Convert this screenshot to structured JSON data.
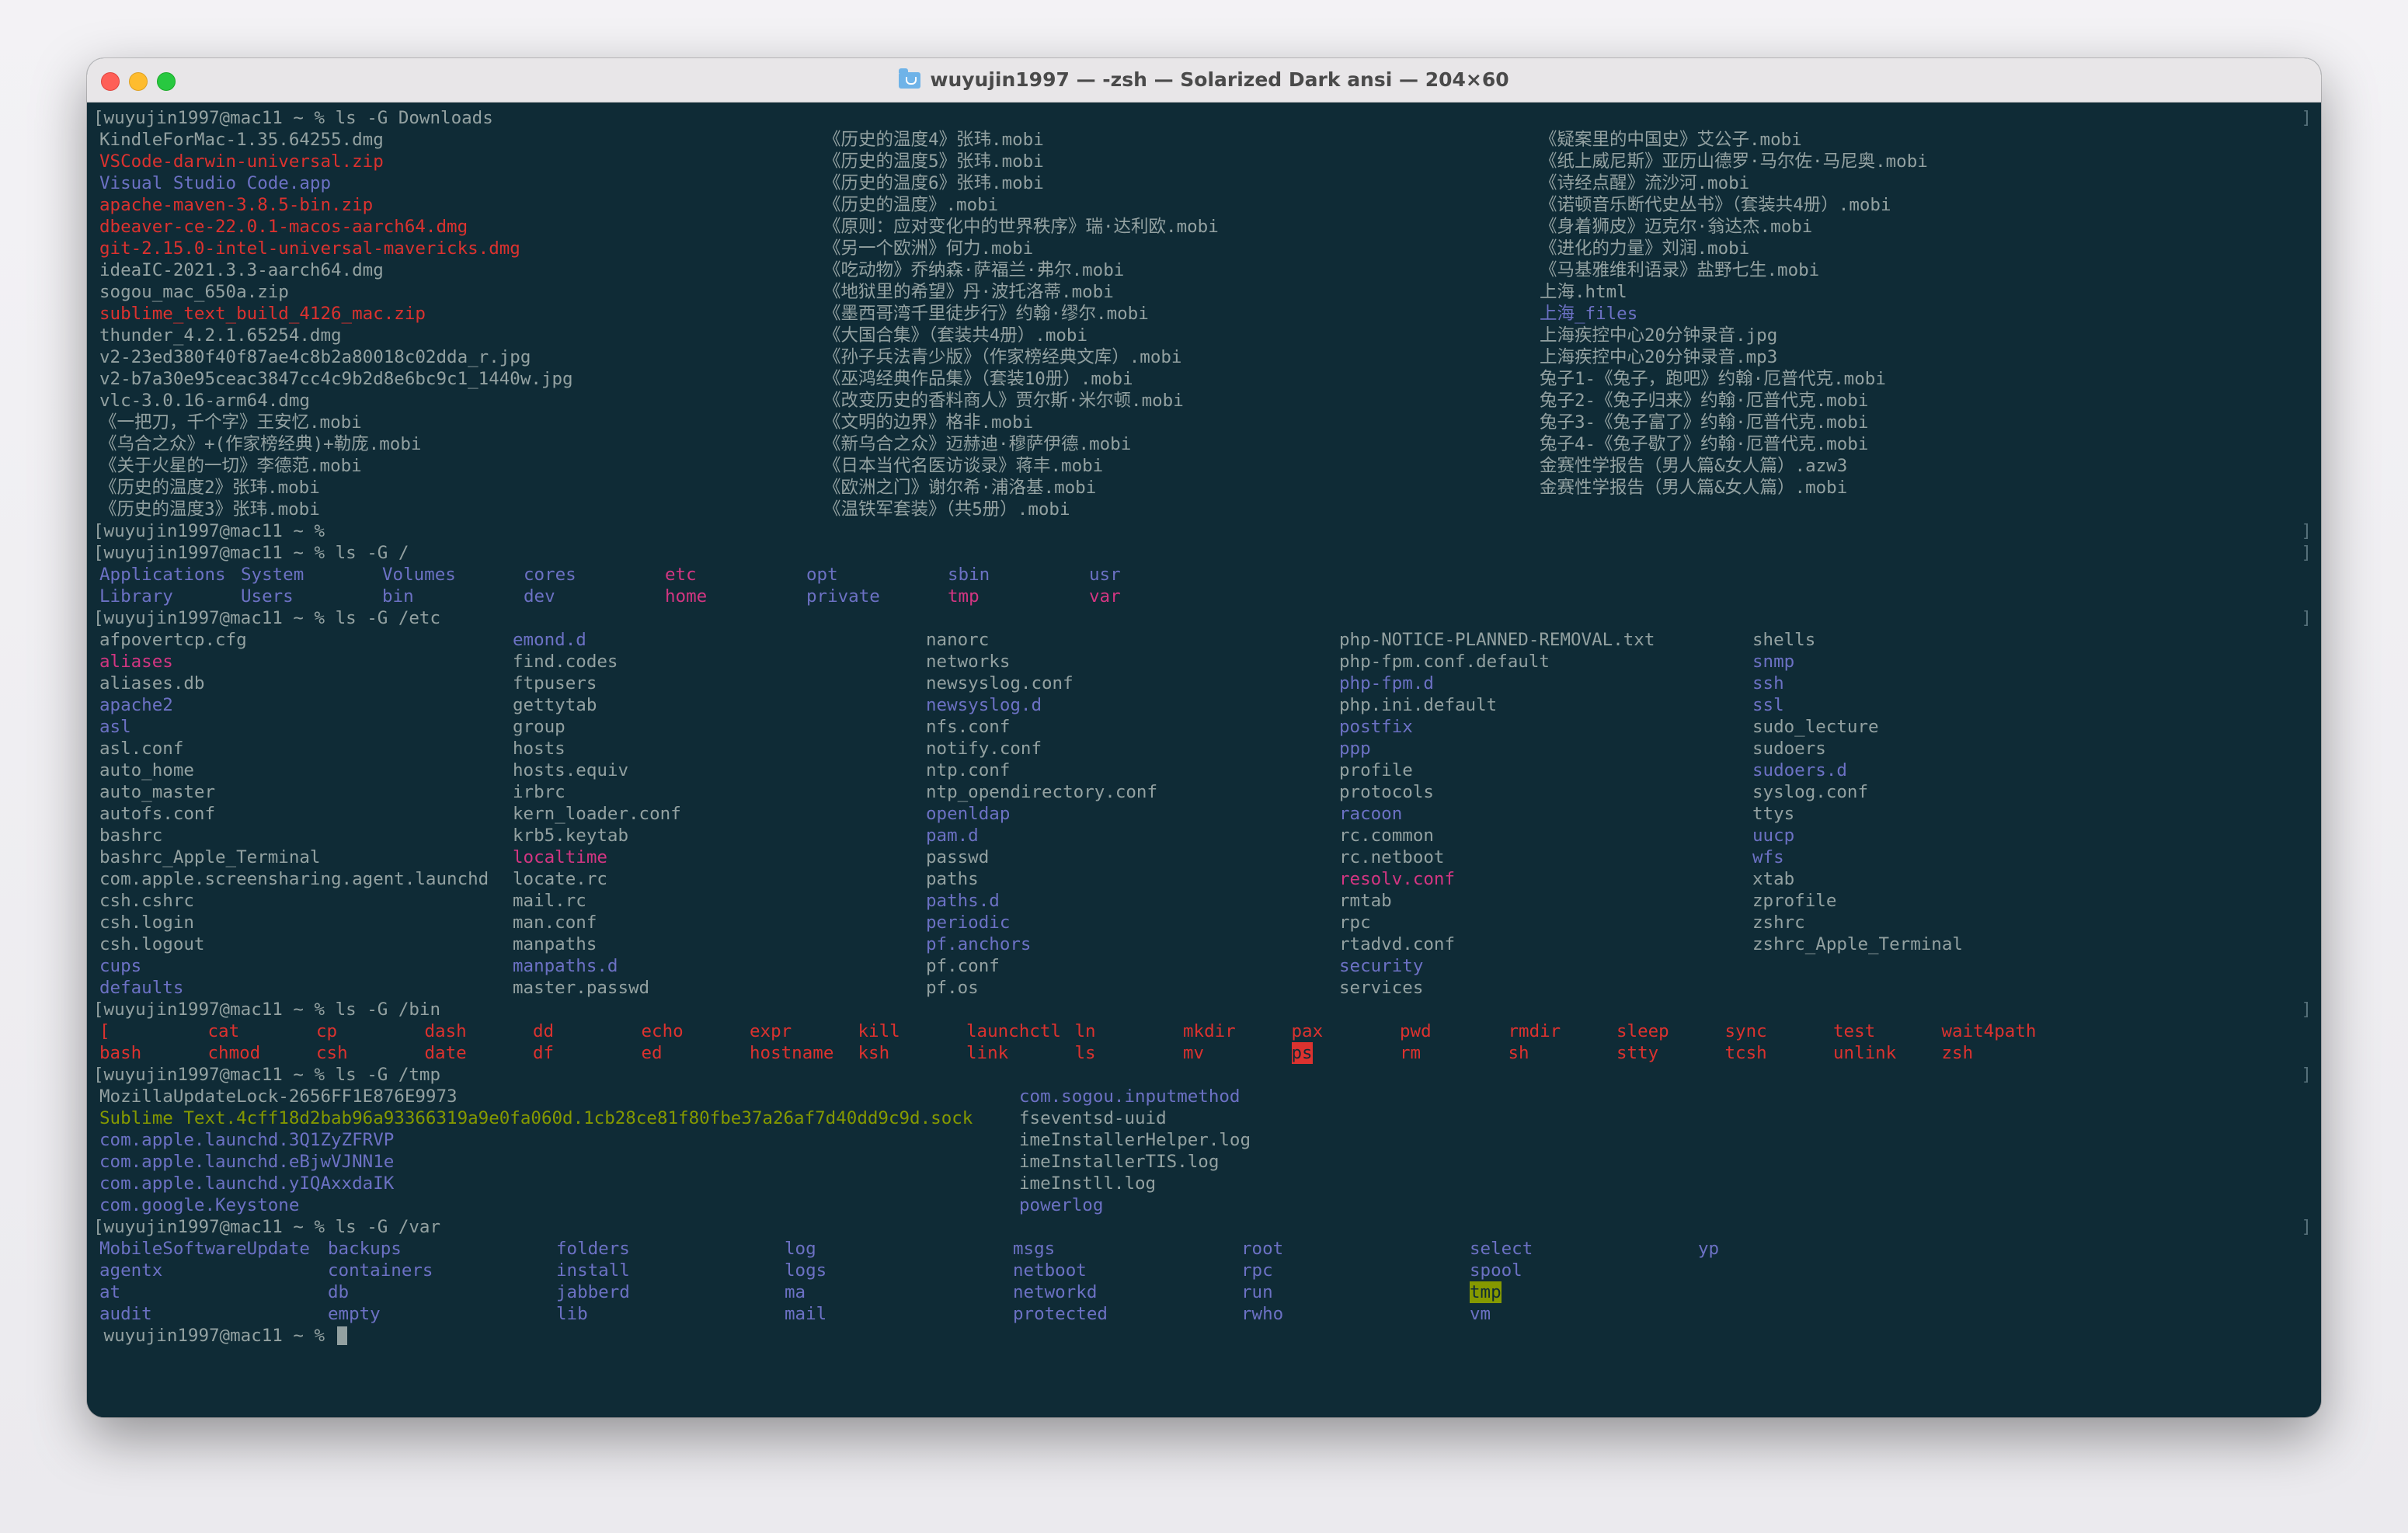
{
  "window": {
    "title": "wuyujin1997 — -zsh — Solarized Dark ansi — 204×60",
    "icon": "folder-icon"
  },
  "colors": {
    "background": "#0f2b36",
    "foreground": "#93a1a1",
    "directory": "#6c71c4",
    "archive": "#dc322f",
    "symlink": "#d33682",
    "socket": "#859900"
  },
  "terminal": {
    "prompt": "[wuyujin1997@mac11 ~ % ",
    "prompt_final": "wuyujin1997@mac11 ~ % ",
    "commands": {
      "downloads": "ls -G Downloads",
      "root": "ls -G /",
      "etc": "ls -G /etc",
      "bin": "ls -G /bin",
      "tmp": "ls -G /tmp",
      "var": "ls -G /var"
    },
    "downloads": [
      [
        {
          "t": "KindleForMac-1.35.64255.dmg",
          "c": "g"
        },
        {
          "t": "《历史的温度4》张玮.mobi",
          "c": "g"
        },
        {
          "t": "《疑案里的中国史》艾公子.mobi",
          "c": "g"
        }
      ],
      [
        {
          "t": "VSCode-darwin-universal.zip",
          "c": "r"
        },
        {
          "t": "《历史的温度5》张玮.mobi",
          "c": "g"
        },
        {
          "t": "《纸上威尼斯》亚历山德罗·马尔佐·马尼奥.mobi",
          "c": "g"
        }
      ],
      [
        {
          "t": "Visual Studio Code.app",
          "c": "d"
        },
        {
          "t": "《历史的温度6》张玮.mobi",
          "c": "g"
        },
        {
          "t": "《诗经点醒》流沙河.mobi",
          "c": "g"
        }
      ],
      [
        {
          "t": "apache-maven-3.8.5-bin.zip",
          "c": "r"
        },
        {
          "t": "《历史的温度》.mobi",
          "c": "g"
        },
        {
          "t": "《诺顿音乐断代史丛书》（套装共4册）.mobi",
          "c": "g"
        }
      ],
      [
        {
          "t": "dbeaver-ce-22.0.1-macos-aarch64.dmg",
          "c": "r"
        },
        {
          "t": "《原则：应对变化中的世界秩序》瑞·达利欧.mobi",
          "c": "g"
        },
        {
          "t": "《身着狮皮》迈克尔·翁达杰.mobi",
          "c": "g"
        }
      ],
      [
        {
          "t": "git-2.15.0-intel-universal-mavericks.dmg",
          "c": "r"
        },
        {
          "t": "《另一个欧洲》何力.mobi",
          "c": "g"
        },
        {
          "t": "《进化的力量》刘润.mobi",
          "c": "g"
        }
      ],
      [
        {
          "t": "ideaIC-2021.3.3-aarch64.dmg",
          "c": "g"
        },
        {
          "t": "《吃动物》乔纳森·萨福兰·弗尔.mobi",
          "c": "g"
        },
        {
          "t": "《马基雅维利语录》盐野七生.mobi",
          "c": "g"
        }
      ],
      [
        {
          "t": "sogou_mac_650a.zip",
          "c": "g"
        },
        {
          "t": "《地狱里的希望》丹·波托洛蒂.mobi",
          "c": "g"
        },
        {
          "t": "上海.html",
          "c": "g"
        }
      ],
      [
        {
          "t": "sublime_text_build_4126_mac.zip",
          "c": "r"
        },
        {
          "t": "《墨西哥湾千里徒步行》约翰·缪尔.mobi",
          "c": "g"
        },
        {
          "t": "上海_files",
          "c": "d"
        }
      ],
      [
        {
          "t": "thunder_4.2.1.65254.dmg",
          "c": "g"
        },
        {
          "t": "《大国合集》（套装共4册）.mobi",
          "c": "g"
        },
        {
          "t": "上海疾控中心20分钟录音.jpg",
          "c": "g"
        }
      ],
      [
        {
          "t": "v2-23ed380f40f87ae4c8b2a80018c02dda_r.jpg",
          "c": "g"
        },
        {
          "t": "《孙子兵法青少版》（作家榜经典文库）.mobi",
          "c": "g"
        },
        {
          "t": "上海疾控中心20分钟录音.mp3",
          "c": "g"
        }
      ],
      [
        {
          "t": "v2-b7a30e95ceac3847cc4c9b2d8e6bc9c1_1440w.jpg",
          "c": "g"
        },
        {
          "t": "《巫鸿经典作品集》（套装10册）.mobi",
          "c": "g"
        },
        {
          "t": "兔子1-《兔子，跑吧》约翰·厄普代克.mobi",
          "c": "g"
        }
      ],
      [
        {
          "t": "vlc-3.0.16-arm64.dmg",
          "c": "g"
        },
        {
          "t": "《改变历史的香料商人》贾尔斯·米尔顿.mobi",
          "c": "g"
        },
        {
          "t": "兔子2-《兔子归来》约翰·厄普代克.mobi",
          "c": "g"
        }
      ],
      [
        {
          "t": "《一把刀，千个字》王安忆.mobi",
          "c": "g"
        },
        {
          "t": "《文明的边界》格非.mobi",
          "c": "g"
        },
        {
          "t": "兔子3-《兔子富了》约翰·厄普代克.mobi",
          "c": "g"
        }
      ],
      [
        {
          "t": "《乌合之众》+(作家榜经典)+勒庞.mobi",
          "c": "g"
        },
        {
          "t": "《新乌合之众》迈赫迪·穆萨伊德.mobi",
          "c": "g"
        },
        {
          "t": "兔子4-《兔子歇了》约翰·厄普代克.mobi",
          "c": "g"
        }
      ],
      [
        {
          "t": "《关于火星的一切》李德范.mobi",
          "c": "g"
        },
        {
          "t": "《日本当代名医访谈录》蒋丰.mobi",
          "c": "g"
        },
        {
          "t": "金赛性学报告（男人篇&女人篇）.azw3",
          "c": "g"
        }
      ],
      [
        {
          "t": "《历史的温度2》张玮.mobi",
          "c": "g"
        },
        {
          "t": "《欧洲之门》谢尔希·浦洛基.mobi",
          "c": "g"
        },
        {
          "t": "金赛性学报告（男人篇&女人篇）.mobi",
          "c": "g"
        }
      ],
      [
        {
          "t": "《历史的温度3》张玮.mobi",
          "c": "g"
        },
        {
          "t": "《温铁军套装》（共5册）.mobi",
          "c": "g"
        },
        {
          "t": "",
          "c": "g"
        }
      ]
    ],
    "root": [
      [
        {
          "t": "Applications",
          "c": "d"
        },
        {
          "t": "System",
          "c": "d"
        },
        {
          "t": "Volumes",
          "c": "d"
        },
        {
          "t": "cores",
          "c": "d"
        },
        {
          "t": "etc",
          "c": "l"
        },
        {
          "t": "opt",
          "c": "d"
        },
        {
          "t": "sbin",
          "c": "d"
        },
        {
          "t": "usr",
          "c": "d"
        }
      ],
      [
        {
          "t": "Library",
          "c": "d"
        },
        {
          "t": "Users",
          "c": "d"
        },
        {
          "t": "bin",
          "c": "d"
        },
        {
          "t": "dev",
          "c": "d"
        },
        {
          "t": "home",
          "c": "l"
        },
        {
          "t": "private",
          "c": "d"
        },
        {
          "t": "tmp",
          "c": "l"
        },
        {
          "t": "var",
          "c": "l"
        }
      ]
    ],
    "etc": [
      [
        {
          "t": "afpovertcp.cfg",
          "c": "g"
        },
        {
          "t": "emond.d",
          "c": "d"
        },
        {
          "t": "nanorc",
          "c": "g"
        },
        {
          "t": "php-NOTICE-PLANNED-REMOVAL.txt",
          "c": "g"
        },
        {
          "t": "shells",
          "c": "g"
        }
      ],
      [
        {
          "t": "aliases",
          "c": "l"
        },
        {
          "t": "find.codes",
          "c": "g"
        },
        {
          "t": "networks",
          "c": "g"
        },
        {
          "t": "php-fpm.conf.default",
          "c": "g"
        },
        {
          "t": "snmp",
          "c": "d"
        }
      ],
      [
        {
          "t": "aliases.db",
          "c": "g"
        },
        {
          "t": "ftpusers",
          "c": "g"
        },
        {
          "t": "newsyslog.conf",
          "c": "g"
        },
        {
          "t": "php-fpm.d",
          "c": "d"
        },
        {
          "t": "ssh",
          "c": "d"
        }
      ],
      [
        {
          "t": "apache2",
          "c": "d"
        },
        {
          "t": "gettytab",
          "c": "g"
        },
        {
          "t": "newsyslog.d",
          "c": "d"
        },
        {
          "t": "php.ini.default",
          "c": "g"
        },
        {
          "t": "ssl",
          "c": "d"
        }
      ],
      [
        {
          "t": "asl",
          "c": "d"
        },
        {
          "t": "group",
          "c": "g"
        },
        {
          "t": "nfs.conf",
          "c": "g"
        },
        {
          "t": "postfix",
          "c": "d"
        },
        {
          "t": "sudo_lecture",
          "c": "g"
        }
      ],
      [
        {
          "t": "asl.conf",
          "c": "g"
        },
        {
          "t": "hosts",
          "c": "g"
        },
        {
          "t": "notify.conf",
          "c": "g"
        },
        {
          "t": "ppp",
          "c": "d"
        },
        {
          "t": "sudoers",
          "c": "g"
        }
      ],
      [
        {
          "t": "auto_home",
          "c": "g"
        },
        {
          "t": "hosts.equiv",
          "c": "g"
        },
        {
          "t": "ntp.conf",
          "c": "g"
        },
        {
          "t": "profile",
          "c": "g"
        },
        {
          "t": "sudoers.d",
          "c": "d"
        }
      ],
      [
        {
          "t": "auto_master",
          "c": "g"
        },
        {
          "t": "irbrc",
          "c": "g"
        },
        {
          "t": "ntp_opendirectory.conf",
          "c": "g"
        },
        {
          "t": "protocols",
          "c": "g"
        },
        {
          "t": "syslog.conf",
          "c": "g"
        }
      ],
      [
        {
          "t": "autofs.conf",
          "c": "g"
        },
        {
          "t": "kern_loader.conf",
          "c": "g"
        },
        {
          "t": "openldap",
          "c": "d"
        },
        {
          "t": "racoon",
          "c": "d"
        },
        {
          "t": "ttys",
          "c": "g"
        }
      ],
      [
        {
          "t": "bashrc",
          "c": "g"
        },
        {
          "t": "krb5.keytab",
          "c": "g"
        },
        {
          "t": "pam.d",
          "c": "d"
        },
        {
          "t": "rc.common",
          "c": "g"
        },
        {
          "t": "uucp",
          "c": "d"
        }
      ],
      [
        {
          "t": "bashrc_Apple_Terminal",
          "c": "g"
        },
        {
          "t": "localtime",
          "c": "l"
        },
        {
          "t": "passwd",
          "c": "g"
        },
        {
          "t": "rc.netboot",
          "c": "g"
        },
        {
          "t": "wfs",
          "c": "d"
        }
      ],
      [
        {
          "t": "com.apple.screensharing.agent.launchd",
          "c": "g"
        },
        {
          "t": "locate.rc",
          "c": "g"
        },
        {
          "t": "paths",
          "c": "g"
        },
        {
          "t": "resolv.conf",
          "c": "l"
        },
        {
          "t": "xtab",
          "c": "g"
        }
      ],
      [
        {
          "t": "csh.cshrc",
          "c": "g"
        },
        {
          "t": "mail.rc",
          "c": "g"
        },
        {
          "t": "paths.d",
          "c": "d"
        },
        {
          "t": "rmtab",
          "c": "g"
        },
        {
          "t": "zprofile",
          "c": "g"
        }
      ],
      [
        {
          "t": "csh.login",
          "c": "g"
        },
        {
          "t": "man.conf",
          "c": "g"
        },
        {
          "t": "periodic",
          "c": "d"
        },
        {
          "t": "rpc",
          "c": "g"
        },
        {
          "t": "zshrc",
          "c": "g"
        }
      ],
      [
        {
          "t": "csh.logout",
          "c": "g"
        },
        {
          "t": "manpaths",
          "c": "g"
        },
        {
          "t": "pf.anchors",
          "c": "d"
        },
        {
          "t": "rtadvd.conf",
          "c": "g"
        },
        {
          "t": "zshrc_Apple_Terminal",
          "c": "g"
        }
      ],
      [
        {
          "t": "cups",
          "c": "d"
        },
        {
          "t": "manpaths.d",
          "c": "d"
        },
        {
          "t": "pf.conf",
          "c": "g"
        },
        {
          "t": "security",
          "c": "d"
        },
        {
          "t": "",
          "c": "g"
        }
      ],
      [
        {
          "t": "defaults",
          "c": "d"
        },
        {
          "t": "master.passwd",
          "c": "g"
        },
        {
          "t": "pf.os",
          "c": "g"
        },
        {
          "t": "services",
          "c": "g"
        },
        {
          "t": "",
          "c": "g"
        }
      ]
    ],
    "bin": [
      [
        {
          "t": "[",
          "c": "r"
        },
        {
          "t": "cat",
          "c": "r"
        },
        {
          "t": "cp",
          "c": "r"
        },
        {
          "t": "dash",
          "c": "r"
        },
        {
          "t": "dd",
          "c": "r"
        },
        {
          "t": "echo",
          "c": "r"
        },
        {
          "t": "expr",
          "c": "r"
        },
        {
          "t": "kill",
          "c": "r"
        },
        {
          "t": "launchctl",
          "c": "r"
        },
        {
          "t": "ln",
          "c": "r"
        },
        {
          "t": "mkdir",
          "c": "r"
        },
        {
          "t": "pax",
          "c": "r"
        },
        {
          "t": "pwd",
          "c": "r"
        },
        {
          "t": "rmdir",
          "c": "r"
        },
        {
          "t": "sleep",
          "c": "r"
        },
        {
          "t": "sync",
          "c": "r"
        },
        {
          "t": "test",
          "c": "r"
        },
        {
          "t": "wait4path",
          "c": "r"
        }
      ],
      [
        {
          "t": "bash",
          "c": "r"
        },
        {
          "t": "chmod",
          "c": "r"
        },
        {
          "t": "csh",
          "c": "r"
        },
        {
          "t": "date",
          "c": "r"
        },
        {
          "t": "df",
          "c": "r"
        },
        {
          "t": "ed",
          "c": "r"
        },
        {
          "t": "hostname",
          "c": "r"
        },
        {
          "t": "ksh",
          "c": "r"
        },
        {
          "t": "link",
          "c": "r"
        },
        {
          "t": "ls",
          "c": "r"
        },
        {
          "t": "mv",
          "c": "r"
        },
        {
          "t": "ps",
          "c": "hr"
        },
        {
          "t": "rm",
          "c": "r"
        },
        {
          "t": "sh",
          "c": "r"
        },
        {
          "t": "stty",
          "c": "r"
        },
        {
          "t": "tcsh",
          "c": "r"
        },
        {
          "t": "unlink",
          "c": "r"
        },
        {
          "t": "zsh",
          "c": "r"
        }
      ]
    ],
    "tmp": [
      [
        {
          "t": "MozillaUpdateLock-2656FF1E876E9973",
          "c": "g"
        },
        {
          "t": "com.sogou.inputmethod",
          "c": "d"
        }
      ],
      [
        {
          "t": "Sublime Text.4cff18d2bab96a93366319a9e0fa060d.1cb28ce81f80fbe37a26af7d40dd9c9d.sock",
          "c": "s"
        },
        {
          "t": "fseventsd-uuid",
          "c": "g"
        }
      ],
      [
        {
          "t": "com.apple.launchd.3Q1ZyZFRVP",
          "c": "d"
        },
        {
          "t": "imeInstallerHelper.log",
          "c": "g"
        }
      ],
      [
        {
          "t": "com.apple.launchd.eBjwVJNN1e",
          "c": "d"
        },
        {
          "t": "imeInstallerTIS.log",
          "c": "g"
        }
      ],
      [
        {
          "t": "com.apple.launchd.yIQAxxdaIK",
          "c": "d"
        },
        {
          "t": "imeInstll.log",
          "c": "g"
        }
      ],
      [
        {
          "t": "com.google.Keystone",
          "c": "d"
        },
        {
          "t": "powerlog",
          "c": "d"
        }
      ]
    ],
    "var": [
      [
        {
          "t": "MobileSoftwareUpdate",
          "c": "d"
        },
        {
          "t": "backups",
          "c": "d"
        },
        {
          "t": "folders",
          "c": "d"
        },
        {
          "t": "log",
          "c": "d"
        },
        {
          "t": "msgs",
          "c": "d"
        },
        {
          "t": "root",
          "c": "d"
        },
        {
          "t": "select",
          "c": "d"
        },
        {
          "t": "yp",
          "c": "d"
        }
      ],
      [
        {
          "t": "agentx",
          "c": "d"
        },
        {
          "t": "containers",
          "c": "d"
        },
        {
          "t": "install",
          "c": "d"
        },
        {
          "t": "logs",
          "c": "d"
        },
        {
          "t": "netboot",
          "c": "d"
        },
        {
          "t": "rpc",
          "c": "d"
        },
        {
          "t": "spool",
          "c": "d"
        },
        {
          "t": "",
          "c": "g"
        }
      ],
      [
        {
          "t": "at",
          "c": "d"
        },
        {
          "t": "db",
          "c": "d"
        },
        {
          "t": "jabberd",
          "c": "d"
        },
        {
          "t": "ma",
          "c": "d"
        },
        {
          "t": "networkd",
          "c": "d"
        },
        {
          "t": "run",
          "c": "d"
        },
        {
          "t": "tmp",
          "c": "hg"
        },
        {
          "t": "",
          "c": "g"
        }
      ],
      [
        {
          "t": "audit",
          "c": "d"
        },
        {
          "t": "empty",
          "c": "d"
        },
        {
          "t": "lib",
          "c": "d"
        },
        {
          "t": "mail",
          "c": "d"
        },
        {
          "t": "protected",
          "c": "d"
        },
        {
          "t": "rwho",
          "c": "d"
        },
        {
          "t": "vm",
          "c": "d"
        },
        {
          "t": "",
          "c": "g"
        }
      ]
    ]
  }
}
